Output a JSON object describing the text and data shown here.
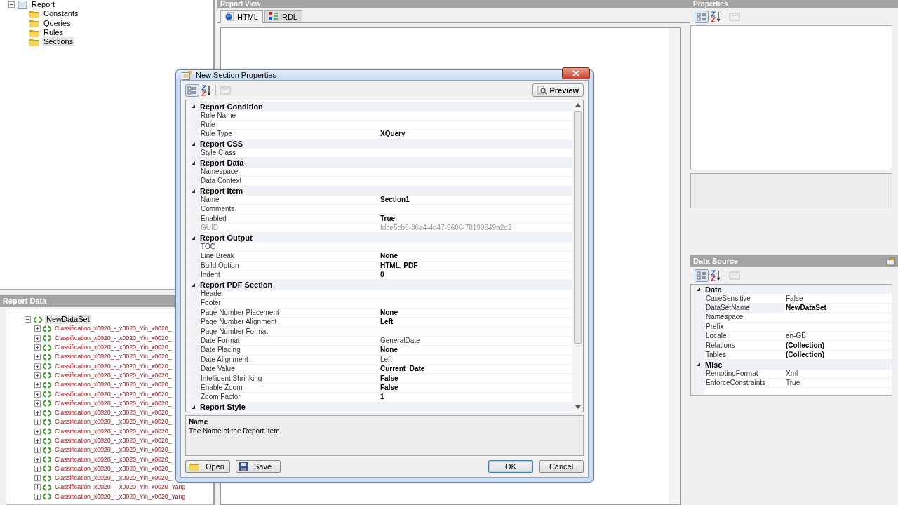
{
  "explorer": {
    "root": {
      "label": "Report",
      "expanded": true,
      "children": [
        {
          "label": "Constants",
          "selected": false
        },
        {
          "label": "Queries",
          "selected": false
        },
        {
          "label": "Rules",
          "selected": false
        },
        {
          "label": "Sections",
          "selected": true
        }
      ]
    }
  },
  "report_view": {
    "title": "Report View",
    "tabs": [
      {
        "label": "HTML",
        "selected": true
      },
      {
        "label": "RDL",
        "selected": false
      }
    ]
  },
  "report_data": {
    "title": "Report Data",
    "root": {
      "label": "NewDataSet",
      "expanded": true,
      "selected": true,
      "children": [
        {
          "label": "Classification_x0020_-_x0020_Yin_x0020_",
          "expanded": false
        },
        {
          "label": "Classification_x0020_-_x0020_Yin_x0020_",
          "expanded": false
        },
        {
          "label": "Classification_x0020_-_x0020_Yin_x0020_",
          "expanded": false
        },
        {
          "label": "Classification_x0020_-_x0020_Yin_x0020_",
          "expanded": false
        },
        {
          "label": "Classification_x0020_-_x0020_Yin_x0020_",
          "expanded": false
        },
        {
          "label": "Classification_x0020_-_x0020_Yin_x0020_",
          "expanded": false
        },
        {
          "label": "Classification_x0020_-_x0020_Yin_x0020_",
          "expanded": false
        },
        {
          "label": "Classification_x0020_-_x0020_Yin_x0020_",
          "expanded": false
        },
        {
          "label": "Classification_x0020_-_x0020_Yin_x0020_",
          "expanded": false
        },
        {
          "label": "Classification_x0020_-_x0020_Yin_x0020_",
          "expanded": false
        },
        {
          "label": "Classification_x0020_-_x0020_Yin_x0020_",
          "expanded": false
        },
        {
          "label": "Classification_x0020_-_x0020_Yin_x0020_",
          "expanded": false
        },
        {
          "label": "Classification_x0020_-_x0020_Yin_x0020_",
          "expanded": false
        },
        {
          "label": "Classification_x0020_-_x0020_Yin_x0020_",
          "expanded": false
        },
        {
          "label": "Classification_x0020_-_x0020_Yin_x0020_",
          "expanded": false
        },
        {
          "label": "Classification_x0020_-_x0020_Yin_x0020_",
          "expanded": false
        },
        {
          "label": "Classification_x0020_-_x0020_Yin_x0020_",
          "expanded": false
        },
        {
          "label": "Classification_x0020_-_x0020_Yin_x0020_Yang",
          "expanded": false
        },
        {
          "label": "Classification_x0020_-_x0020_Yin_x0020_Yang",
          "expanded": false
        }
      ]
    }
  },
  "properties_panel": {
    "title": "Properties"
  },
  "data_source": {
    "title": "Data Source",
    "categories": [
      {
        "name": "Data",
        "expanded": true,
        "rows": [
          {
            "name": "CaseSensitive",
            "value": "False",
            "modified": false,
            "selected": false
          },
          {
            "name": "DataSetName",
            "value": "NewDataSet",
            "modified": true,
            "selected": true
          },
          {
            "name": "Namespace",
            "selected": false
          },
          {
            "name": "Prefix",
            "selected": false
          },
          {
            "name": "Locale",
            "value": "en-GB",
            "modified": false,
            "selected": false
          },
          {
            "name": "Relations",
            "value": "(Collection)",
            "modified": true,
            "selected": false
          },
          {
            "name": "Tables",
            "value": "(Collection)",
            "modified": true,
            "selected": false
          }
        ]
      },
      {
        "name": "Misc",
        "expanded": true,
        "rows": [
          {
            "name": "RemotingFormat",
            "value": "Xml",
            "modified": false,
            "selected": false
          },
          {
            "name": "EnforceConstraints",
            "value": "True",
            "modified": false,
            "selected": false
          }
        ]
      }
    ]
  },
  "dialog": {
    "title": "New Section Properties",
    "preview_button": "Preview",
    "categories": [
      {
        "name": "Report Condition",
        "expanded": true,
        "rows": [
          {
            "name": "Rule Name",
            "readonly": false
          },
          {
            "name": "Rule",
            "readonly": false
          },
          {
            "name": "Rule Type",
            "value": "XQuery",
            "modified": true,
            "readonly": false
          }
        ]
      },
      {
        "name": "Report CSS",
        "expanded": true,
        "rows": [
          {
            "name": "Style Class",
            "readonly": false
          }
        ]
      },
      {
        "name": "Report Data",
        "expanded": true,
        "rows": [
          {
            "name": "Namespace",
            "readonly": false
          },
          {
            "name": "Data Context",
            "readonly": false
          }
        ]
      },
      {
        "name": "Report Item",
        "expanded": true,
        "rows": [
          {
            "name": "Name",
            "value": "Section1",
            "modified": true,
            "readonly": false
          },
          {
            "name": "Comments",
            "readonly": false
          },
          {
            "name": "Enabled",
            "value": "True",
            "modified": true,
            "readonly": false
          },
          {
            "name": "GUID",
            "value": "fdce5cb6-36a4-4d47-9606-78190849a2d2",
            "modified": false,
            "readonly": true
          }
        ]
      },
      {
        "name": "Report Output",
        "expanded": true,
        "rows": [
          {
            "name": "TOC",
            "readonly": false
          },
          {
            "name": "Line Break",
            "value": "None",
            "modified": true,
            "readonly": false
          },
          {
            "name": "Build Option",
            "value": "HTML, PDF",
            "modified": true,
            "readonly": false
          },
          {
            "name": "Indent",
            "value": "0",
            "modified": true,
            "readonly": false
          }
        ]
      },
      {
        "name": "Report PDF Section",
        "expanded": true,
        "rows": [
          {
            "name": "Header",
            "readonly": false
          },
          {
            "name": "Footer",
            "readonly": false
          },
          {
            "name": "Page Number Placement",
            "value": "None",
            "modified": true,
            "readonly": false
          },
          {
            "name": "Page Number Alignment",
            "value": "Left",
            "modified": true,
            "readonly": false
          },
          {
            "name": "Page Number Format",
            "readonly": false
          },
          {
            "name": "Date Format",
            "value": "GeneralDate",
            "modified": false,
            "readonly": false
          },
          {
            "name": "Date Placing",
            "value": "None",
            "modified": true,
            "readonly": false
          },
          {
            "name": "Date Alignment",
            "value": "Left",
            "modified": false,
            "readonly": false
          },
          {
            "name": "Date Value",
            "value": "Current_Date",
            "modified": true,
            "readonly": false
          },
          {
            "name": "Intelligent Shrinking",
            "value": "False",
            "modified": true,
            "readonly": false
          },
          {
            "name": "Enable Zoom",
            "value": "False",
            "modified": true,
            "readonly": false
          },
          {
            "name": "Zoom Factor",
            "value": "1",
            "modified": true,
            "readonly": false
          }
        ]
      },
      {
        "name": "Report Style",
        "expanded": true
      }
    ],
    "description": {
      "title": "Name",
      "text": "The Name of the Report Item."
    },
    "buttons": [
      {
        "label": "Open",
        "kind": "open",
        "focused": false
      },
      {
        "label": "Save",
        "kind": "save",
        "focused": false
      },
      {
        "label": "OK",
        "kind": "plain",
        "focused": true
      },
      {
        "label": "Cancel",
        "kind": "plain",
        "focused": false
      }
    ]
  }
}
